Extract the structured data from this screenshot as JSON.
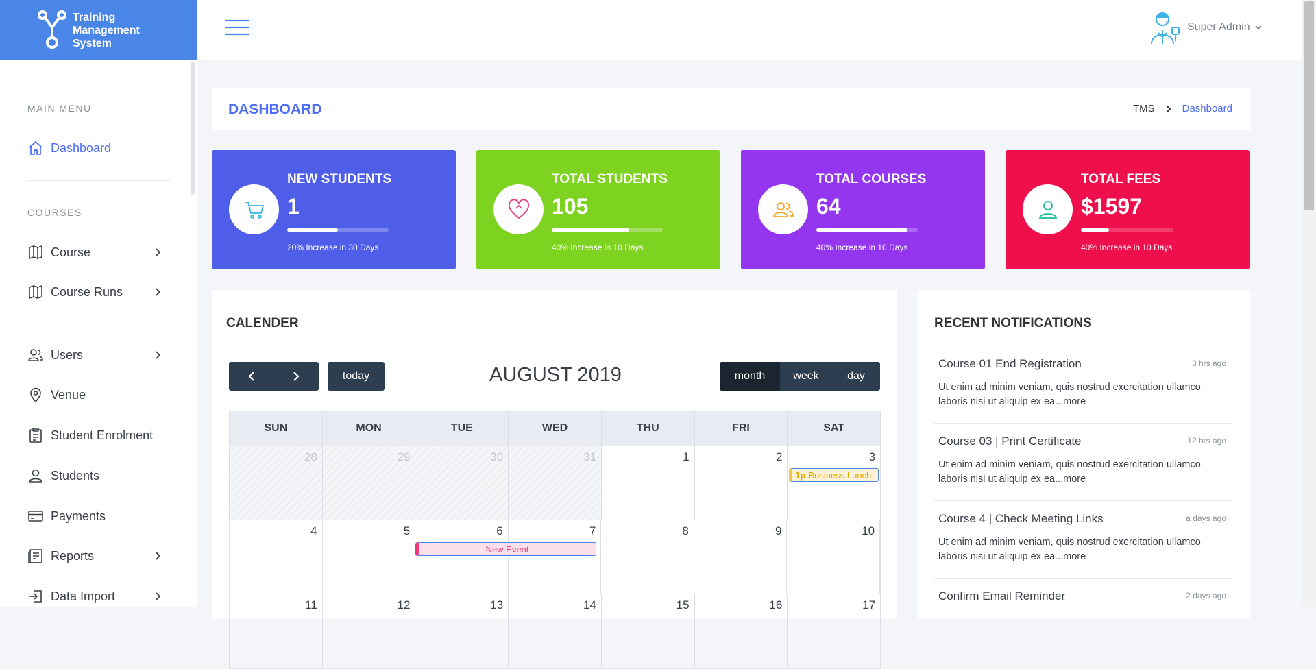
{
  "app": {
    "logo_lines": [
      "Training",
      "Management",
      "System"
    ]
  },
  "sidebar": {
    "sections": [
      {
        "title": "MAIN MENU"
      },
      {
        "title": "COURSES"
      }
    ],
    "items": [
      {
        "label": "Dashboard",
        "icon": "home-icon",
        "active": true,
        "has_submenu": false
      },
      {
        "label": "Course",
        "icon": "map-icon",
        "has_submenu": true
      },
      {
        "label": "Course Runs",
        "icon": "map-icon",
        "has_submenu": true
      },
      {
        "label": "Users",
        "icon": "users-icon",
        "has_submenu": true
      },
      {
        "label": "Venue",
        "icon": "location-pin-icon",
        "has_submenu": false
      },
      {
        "label": "Student Enrolment",
        "icon": "clipboard-icon",
        "has_submenu": false
      },
      {
        "label": "Students",
        "icon": "user-icon",
        "has_submenu": false
      },
      {
        "label": "Payments",
        "icon": "credit-card-icon",
        "has_submenu": false
      },
      {
        "label": "Reports",
        "icon": "report-icon",
        "has_submenu": true
      },
      {
        "label": "Data Import",
        "icon": "import-icon",
        "has_submenu": true
      }
    ]
  },
  "header": {
    "user_name": "Super Admin"
  },
  "page": {
    "title": "DASHBOARD",
    "breadcrumb": [
      "TMS",
      "Dashboard"
    ]
  },
  "stats": [
    {
      "title": "NEW STUDENTS",
      "value": "1",
      "note": "20% Increase in 30 Days",
      "progress": 0.5,
      "color": "#4f5ee8",
      "icon": "cart-icon",
      "icon_color": "#3bb4e5"
    },
    {
      "title": "TOTAL STUDENTS",
      "value": "105",
      "note": "40% Increase in 10 Days",
      "progress": 0.7,
      "color": "#7ed321",
      "icon": "heart-icon",
      "icon_color": "#ee3b7c"
    },
    {
      "title": "TOTAL COURSES",
      "value": "64",
      "note": "40% Increase in 10 Days",
      "progress": 0.9,
      "color": "#9436f0",
      "icon": "users-icon",
      "icon_color": "#f5a623"
    },
    {
      "title": "TOTAL FEES",
      "value": "$1597",
      "note": "40% Increase in 10 Days",
      "progress": 0.3,
      "color": "#ee0f4c",
      "icon": "user-icon",
      "icon_color": "#1abc9c"
    }
  ],
  "calendar": {
    "title": "CALENDER",
    "month_label": "AUGUST 2019",
    "today_label": "today",
    "views": [
      "month",
      "week",
      "day"
    ],
    "active_view": "month",
    "weekdays": [
      "SUN",
      "MON",
      "TUE",
      "WED",
      "THU",
      "FRI",
      "SAT"
    ],
    "weeks": [
      [
        "28",
        "29",
        "30",
        "31",
        "1",
        "2",
        "3"
      ],
      [
        "4",
        "5",
        "6",
        "7",
        "8",
        "9",
        "10"
      ],
      [
        "11",
        "12",
        "13",
        "14",
        "15",
        "16",
        "17"
      ]
    ],
    "events": [
      {
        "time": "1p",
        "title": "Business Lunch"
      },
      {
        "title": "New Event"
      }
    ]
  },
  "notifications": {
    "title": "RECENT NOTIFICATIONS",
    "items": [
      {
        "title": "Course 01 End Registration",
        "time": "3 hrs ago",
        "body": "Ut enim ad minim veniam, quis nostrud exercitation ullamco laboris nisi ut aliquip ex ea...more"
      },
      {
        "title": "Course 03 | Print Certificate",
        "time": "12 hrs ago",
        "body": "Ut enim ad minim veniam, quis nostrud exercitation ullamco laboris nisi ut aliquip ex ea...more"
      },
      {
        "title": "Course 4 | Check Meeting Links",
        "time": "a days ago",
        "body": "Ut enim ad minim veniam, quis nostrud exercitation ullamco laboris nisi ut aliquip ex ea...more"
      },
      {
        "title": "Confirm Email Reminder",
        "time": "2 days ago",
        "body": ""
      }
    ]
  }
}
